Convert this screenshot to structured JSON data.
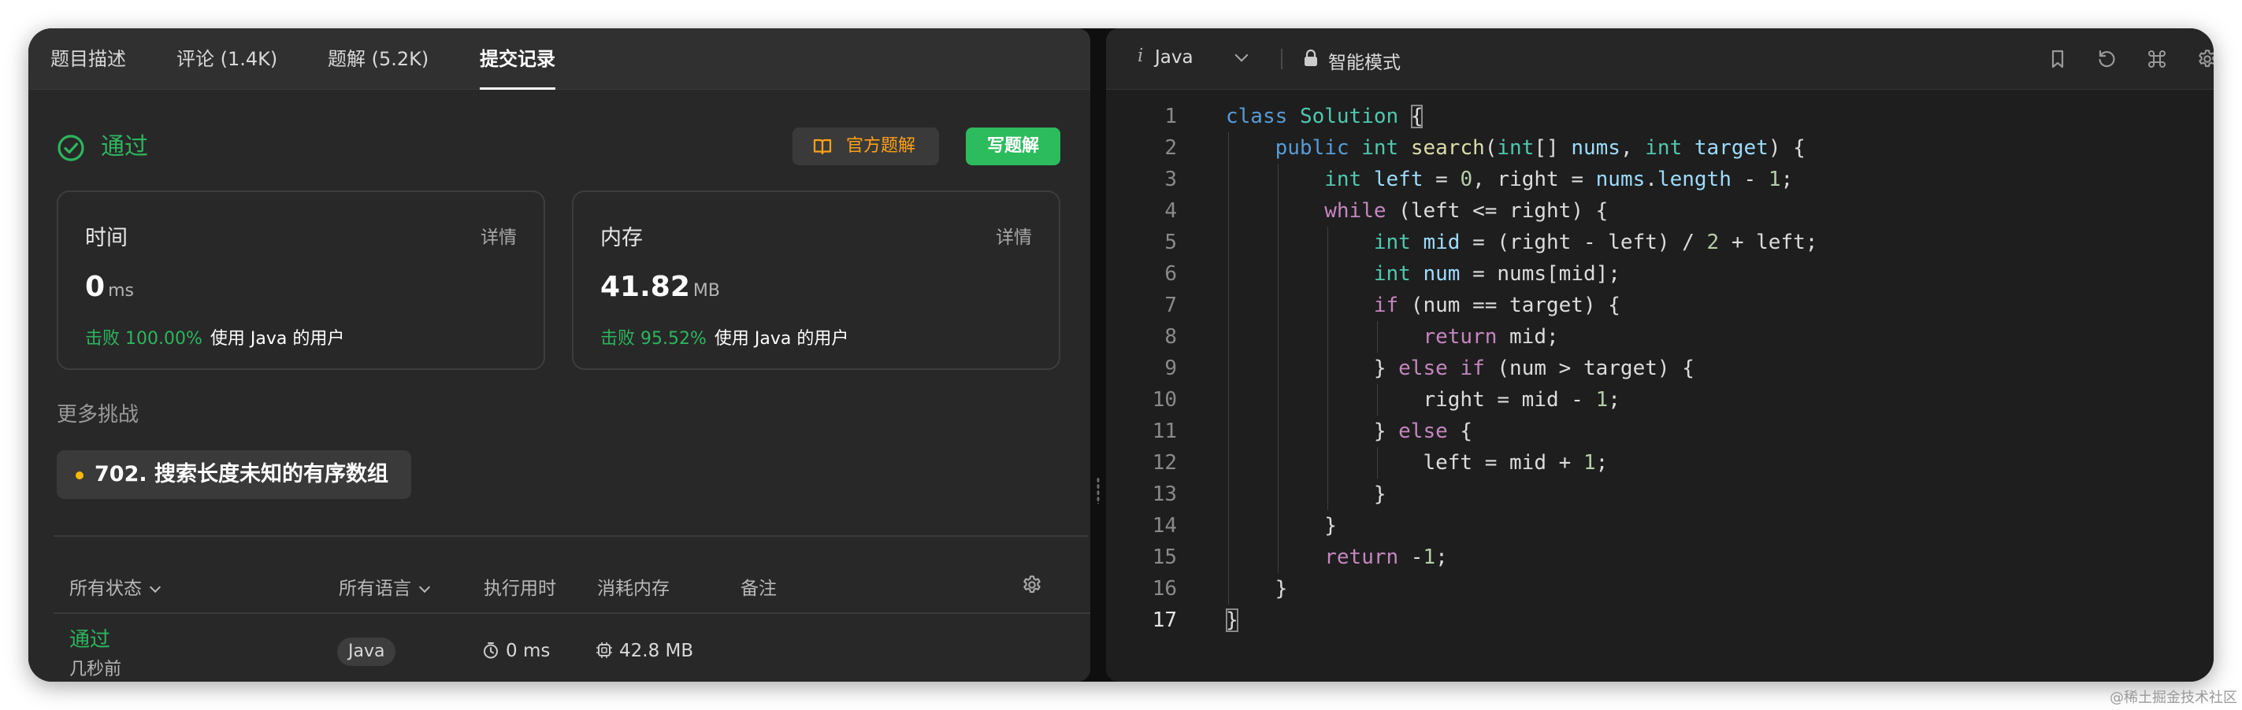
{
  "tabs": [
    "题目描述",
    "评论 (1.4K)",
    "题解 (5.2K)",
    "提交记录"
  ],
  "submission": {
    "status": "通过",
    "official_solution_label": "官方题解",
    "write_solution_label": "写题解"
  },
  "runtime_card": {
    "title": "时间",
    "detail": "详情",
    "value": "0",
    "unit": "ms",
    "beat_percent": "击败 100.00%",
    "beat_suffix": "使用 Java 的用户"
  },
  "memory_card": {
    "title": "内存",
    "detail": "详情",
    "value": "41.82",
    "unit": "MB",
    "beat_percent": "击败 95.52%",
    "beat_suffix": "使用 Java 的用户"
  },
  "more_challenges": {
    "title": "更多挑战",
    "items": [
      "702. 搜索长度未知的有序数组"
    ]
  },
  "table": {
    "headers": [
      "所有状态",
      "所有语言",
      "执行用时",
      "消耗内存",
      "备注"
    ],
    "rows": [
      {
        "status": "通过",
        "time": "几秒前",
        "language": "Java",
        "runtime": "0 ms",
        "memory": "42.8 MB"
      }
    ]
  },
  "editor": {
    "language": "Java",
    "mode": "智能模式",
    "line_numbers": [
      "1",
      "2",
      "3",
      "4",
      "5",
      "6",
      "7",
      "8",
      "9",
      "10",
      "11",
      "12",
      "13",
      "14",
      "15",
      "16",
      "17"
    ],
    "current_line": 17
  },
  "icons": {
    "status": "check-circle-icon",
    "official": "book-open-icon",
    "header": [
      "bookmark-icon",
      "reset-icon",
      "command-icon",
      "settings-icon"
    ]
  },
  "colors": {
    "accent_green": "#2cbb5d",
    "accent_orange": "#ffa116",
    "panel_bg": "#282828",
    "editor_bg": "#1e1e1e"
  },
  "watermark": "@稀土掘金技术社区"
}
